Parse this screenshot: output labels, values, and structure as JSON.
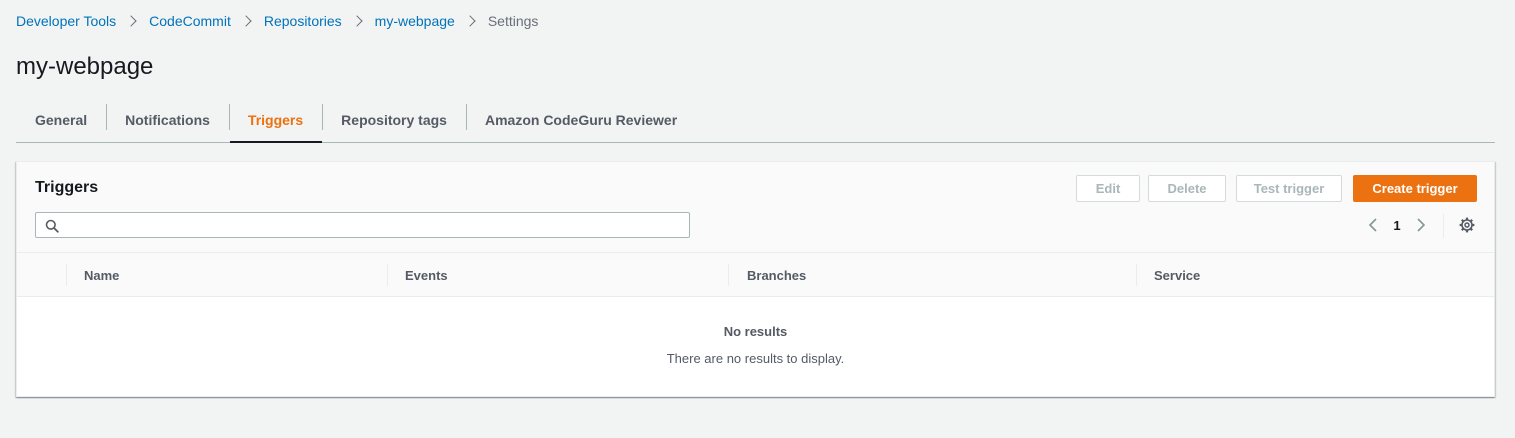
{
  "breadcrumb": {
    "items": [
      {
        "label": "Developer Tools"
      },
      {
        "label": "CodeCommit"
      },
      {
        "label": "Repositories"
      },
      {
        "label": "my-webpage"
      }
    ],
    "current": "Settings"
  },
  "page": {
    "title": "my-webpage"
  },
  "tabs": [
    {
      "label": "General",
      "active": false
    },
    {
      "label": "Notifications",
      "active": false
    },
    {
      "label": "Triggers",
      "active": true
    },
    {
      "label": "Repository tags",
      "active": false
    },
    {
      "label": "Amazon CodeGuru Reviewer",
      "active": false
    }
  ],
  "triggers_panel": {
    "title": "Triggers",
    "buttons": {
      "edit": "Edit",
      "delete": "Delete",
      "test": "Test trigger",
      "create": "Create trigger"
    },
    "search": {
      "value": "",
      "placeholder": ""
    },
    "pagination": {
      "current_page": "1"
    },
    "table": {
      "columns": [
        "Name",
        "Events",
        "Branches",
        "Service"
      ],
      "rows": []
    },
    "empty_state": {
      "title": "No results",
      "description": "There are no results to display."
    }
  },
  "colors": {
    "link": "#0073bb",
    "accent": "#ec7211",
    "background": "#f2f3f3",
    "text_primary": "#16191f",
    "text_secondary": "#545b64"
  },
  "icons": {
    "breadcrumb_separator": "chevron-right-icon",
    "search": "search-icon",
    "prev_page": "chevron-left-icon",
    "next_page": "chevron-right-icon",
    "settings": "gear-icon"
  }
}
